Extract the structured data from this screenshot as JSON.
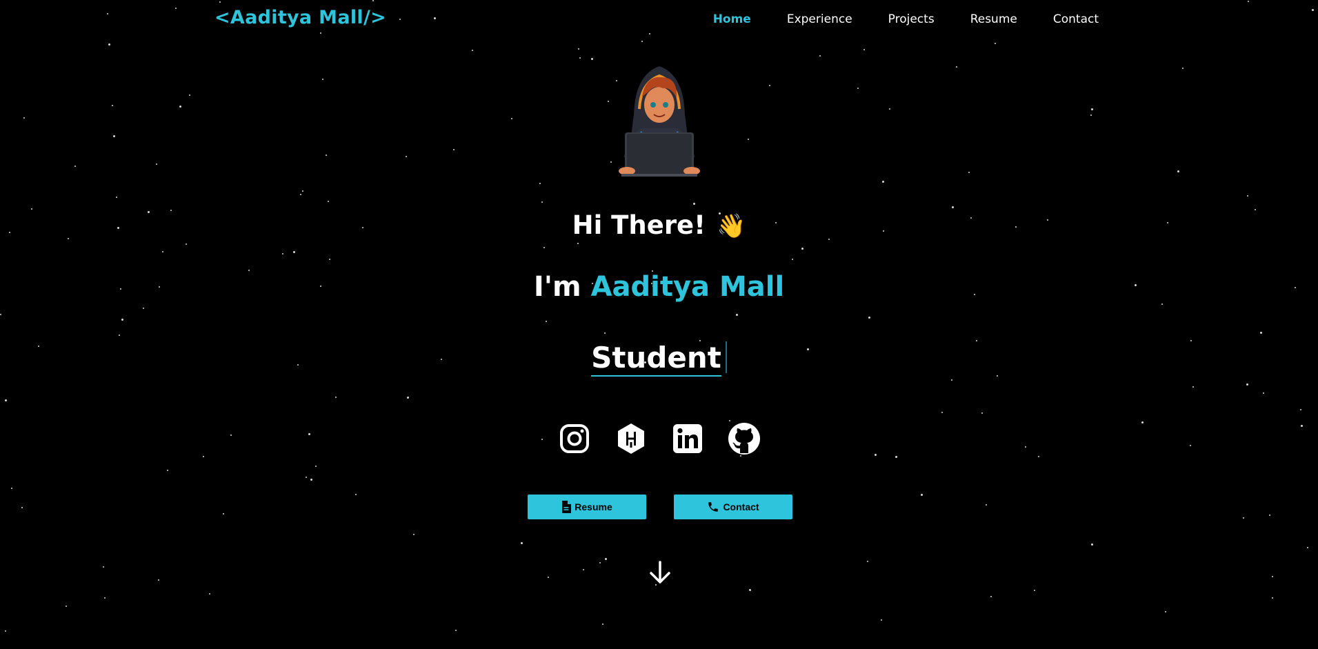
{
  "header": {
    "brand": "<Aaditya Mall/>",
    "nav": [
      {
        "label": "Home",
        "active": true
      },
      {
        "label": "Experience",
        "active": false
      },
      {
        "label": "Projects",
        "active": false
      },
      {
        "label": "Resume",
        "active": false
      },
      {
        "label": "Contact",
        "active": false
      }
    ]
  },
  "hero": {
    "greeting": "Hi There!",
    "greeting_emoji": "👋",
    "intro_prefix": "I'm",
    "name": "Aaditya Mall",
    "role": "Student"
  },
  "socials": [
    {
      "name": "instagram-icon"
    },
    {
      "name": "hashnode-icon"
    },
    {
      "name": "linkedin-icon"
    },
    {
      "name": "github-icon"
    }
  ],
  "buttons": {
    "resume_label": "Resume",
    "contact_label": "Contact"
  },
  "colors": {
    "accent": "#2ec4dc",
    "background": "#000000",
    "text": "#ffffff"
  }
}
